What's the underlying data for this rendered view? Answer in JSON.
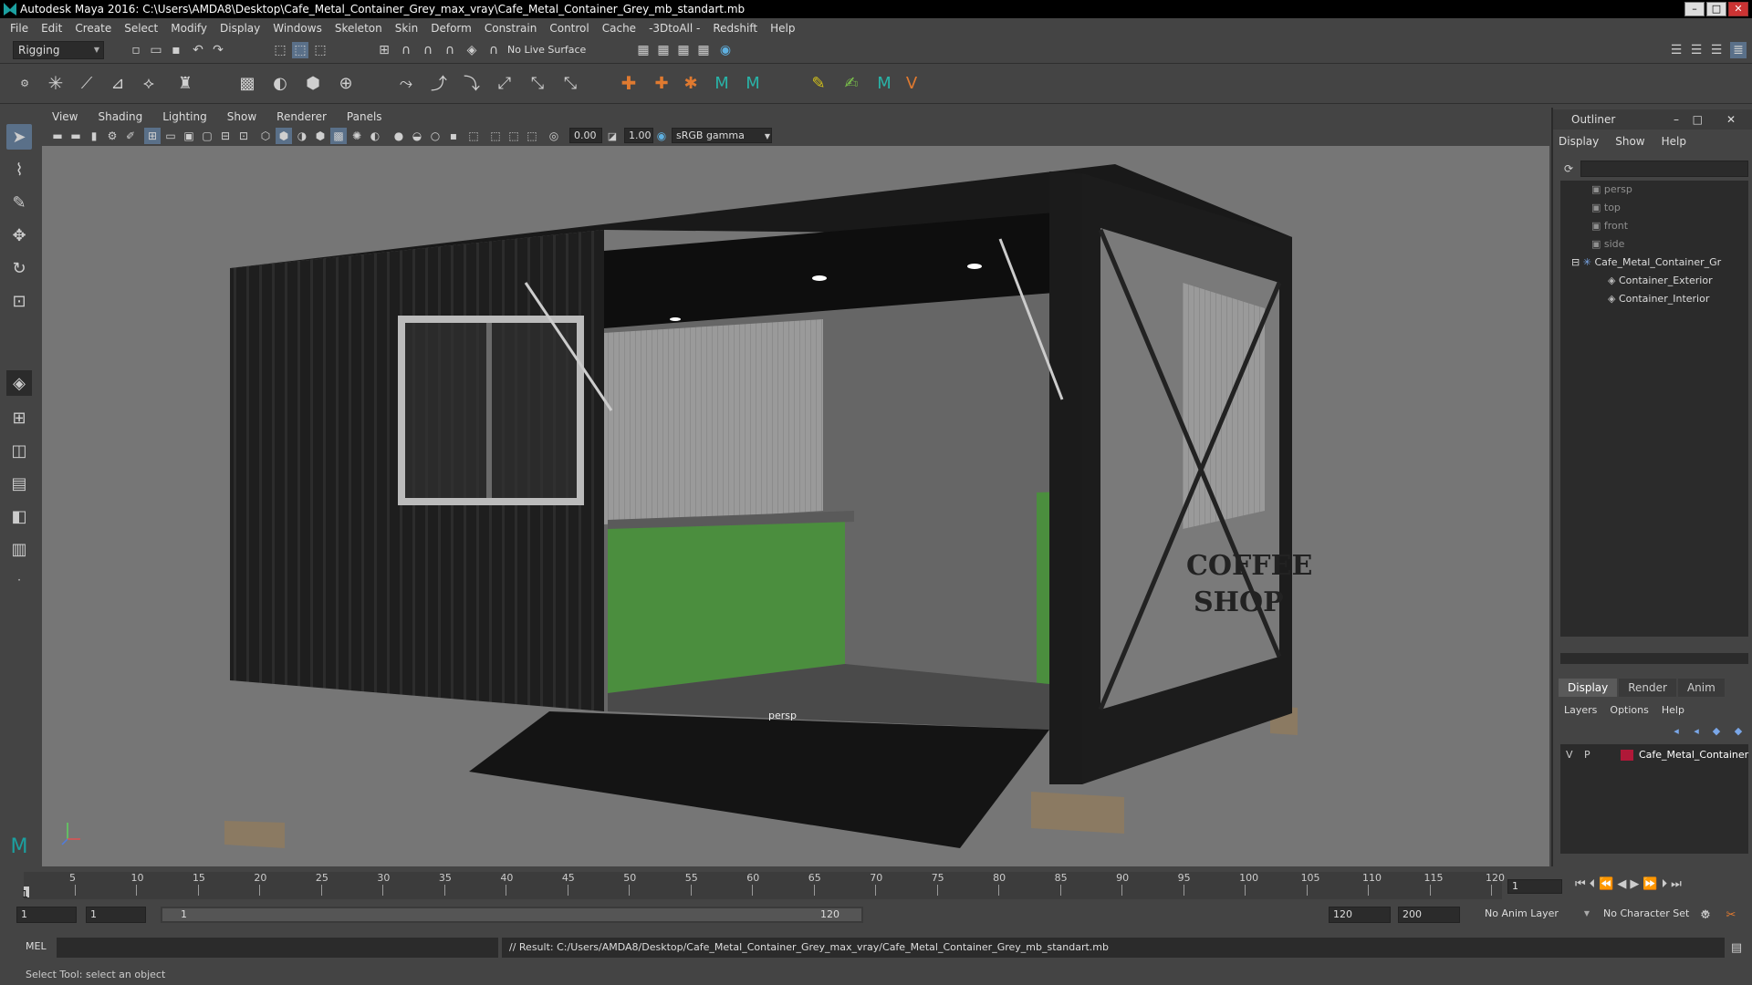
{
  "window": {
    "title": "Autodesk Maya 2016: C:\\Users\\AMDA8\\Desktop\\Cafe_Metal_Container_Grey_max_vray\\Cafe_Metal_Container_Grey_mb_standart.mb"
  },
  "menubar": [
    "File",
    "Edit",
    "Create",
    "Select",
    "Modify",
    "Display",
    "Windows",
    "Skeleton",
    "Skin",
    "Deform",
    "Constrain",
    "Control",
    "Cache",
    "-3DtoAll -",
    "Redshift",
    "Help"
  ],
  "statusline": {
    "menuset": "Rigging",
    "live_surface": "No Live Surface"
  },
  "viewport": {
    "menu": [
      "View",
      "Shading",
      "Lighting",
      "Show",
      "Renderer",
      "Panels"
    ],
    "exposure": "0.00",
    "gamma": "1.00",
    "color_space": "sRGB gamma",
    "camera_label": "persp",
    "sign_line1": "COFFEE",
    "sign_line2": "SHOP"
  },
  "outliner": {
    "title": "Outliner",
    "menu": [
      "Display",
      "Show",
      "Help"
    ],
    "cameras": [
      "persp",
      "top",
      "front",
      "side"
    ],
    "group": "Cafe_Metal_Container_Gr",
    "children": [
      "Container_Exterior",
      "Container_Interior"
    ]
  },
  "layers": {
    "tabs": [
      "Display",
      "Render",
      "Anim"
    ],
    "menu": [
      "Layers",
      "Options",
      "Help"
    ],
    "row": {
      "v": "V",
      "p": "P",
      "name": "Cafe_Metal_Container"
    }
  },
  "timeline": {
    "ticks": [
      "5",
      "10",
      "15",
      "20",
      "25",
      "30",
      "35",
      "40",
      "45",
      "50",
      "55",
      "60",
      "65",
      "70",
      "75",
      "80",
      "85",
      "90",
      "95",
      "100",
      "105",
      "110",
      "115",
      "120"
    ],
    "start_marker": "1",
    "current_frame": "1"
  },
  "range": {
    "start": "1",
    "playback_start": "1",
    "slider_start": "1",
    "slider_end": "120",
    "playback_end": "120",
    "end": "200",
    "anim_layer": "No Anim Layer",
    "char_set": "No Character Set"
  },
  "cmd": {
    "lang": "MEL",
    "result": "// Result: C:/Users/AMDA8/Desktop/Cafe_Metal_Container_Grey_max_vray/Cafe_Metal_Container_Grey_mb_standart.mb"
  },
  "help_line": "Select Tool: select an object",
  "colors": {
    "layer_swatch": "#b01838",
    "accent": "#5a7089",
    "maya_logo": "#1ba0a0"
  }
}
